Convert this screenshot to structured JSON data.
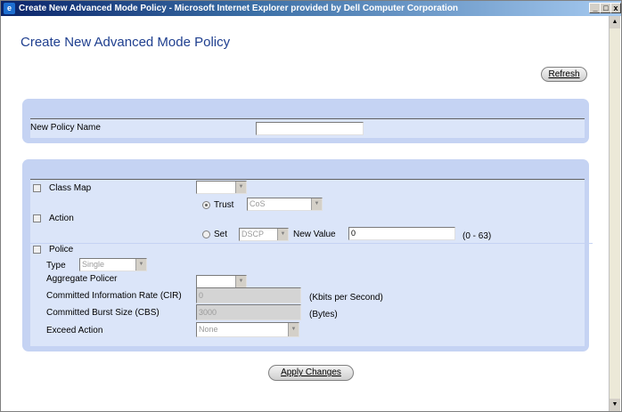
{
  "window": {
    "title": "Create New Advanced Mode Policy - Microsoft Internet Explorer provided by Dell Computer Corporation"
  },
  "page": {
    "heading": "Create New Advanced Mode Policy",
    "refresh_label": "Refresh",
    "apply_label": "Apply Changes"
  },
  "policy": {
    "name_label": "New Policy Name",
    "name_value": ""
  },
  "form": {
    "class_map_label": "Class Map",
    "class_map_value": "",
    "action_label": "Action",
    "trust_label": "Trust",
    "trust_value": "CoS",
    "set_label": "Set",
    "set_value": "DSCP",
    "new_value_label": "New Value",
    "new_value_value": "0",
    "new_value_range": "(0 - 63)",
    "police_label": "Police",
    "type_label": "Type",
    "type_value": "Single",
    "aggregate_label": "Aggregate Policer",
    "aggregate_value": "",
    "cir_label": "Committed Information Rate (CIR)",
    "cir_value": "0",
    "cir_unit": "(Kbits per Second)",
    "cbs_label": "Committed Burst Size (CBS)",
    "cbs_value": "3000",
    "cbs_unit": "(Bytes)",
    "exceed_label": "Exceed Action",
    "exceed_value": "None"
  }
}
